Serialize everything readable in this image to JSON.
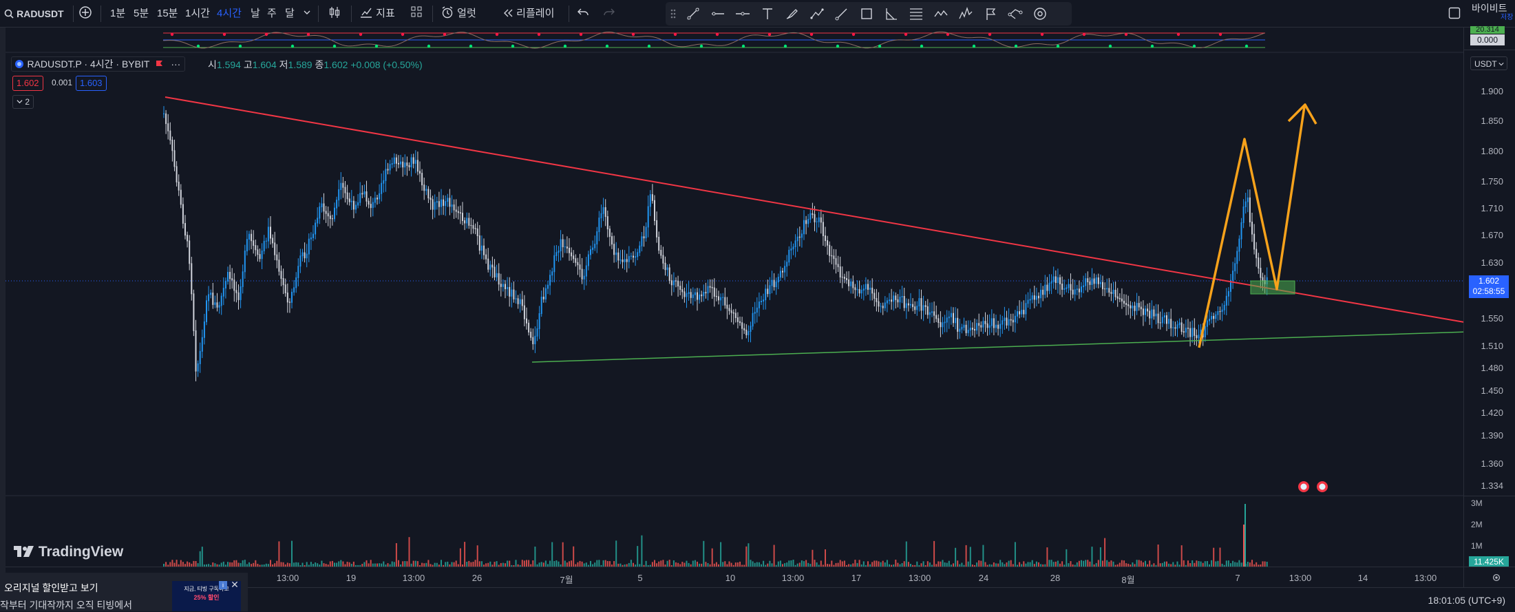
{
  "toolbar": {
    "symbol": "RADUSDT",
    "intervals": [
      "1분",
      "5분",
      "15분",
      "1시간",
      "4시간",
      "날",
      "주",
      "달"
    ],
    "active_interval": "4시간",
    "indicators_label": "지표",
    "alert_label": "얼럿",
    "replay_label": "리플레이",
    "right_label": "바이비트",
    "right_sub": "저장"
  },
  "legend": {
    "title": "RADUSDT.P · 4시간 · BYBIT",
    "o_label": "시",
    "o": "1.594",
    "h_label": "고",
    "h": "1.604",
    "l_label": "저",
    "l": "1.589",
    "c_label": "종",
    "c": "1.602",
    "change": "+0.008 (+0.50%)",
    "bid": "1.602",
    "spread": "0.001",
    "ask": "1.603",
    "collapse_count": "2"
  },
  "osc": {
    "values": [
      "20.314",
      "0.000"
    ]
  },
  "axis": {
    "currency": "USDT",
    "ticks": [
      "1.900",
      "1.850",
      "1.800",
      "1.750",
      "1.710",
      "1.670",
      "1.630",
      "1.550",
      "1.510",
      "1.480",
      "1.450",
      "1.420",
      "1.390",
      "1.360",
      "1.334"
    ],
    "price_label": "1.602",
    "countdown": "02:58:55",
    "volume_ticks": [
      "3M",
      "2M",
      "1M"
    ],
    "volume_label": "11.425K"
  },
  "time_axis": [
    "13:00",
    "19",
    "13:00",
    "26",
    "7월",
    "5",
    "10",
    "13:00",
    "17",
    "13:00",
    "24",
    "28",
    "8월",
    "7",
    "13:00",
    "14",
    "13:00"
  ],
  "clock": "18:01:05 (UTC+9)",
  "watermark": "TradingView",
  "promo": {
    "title": "오리지널 할인받고 보기",
    "text": "작부터 기대작까지 오직 티빙에서",
    "ad_line1": "지금, 티빙 구독하고",
    "ad_line2": "25% 할인"
  },
  "colors": {
    "background": "#131722",
    "bull": "#26a69a",
    "bear": "#ef5350",
    "resistance": "#f23645",
    "support": "#4caf50",
    "projection": "#f7a21b",
    "accent": "#2962ff"
  }
}
